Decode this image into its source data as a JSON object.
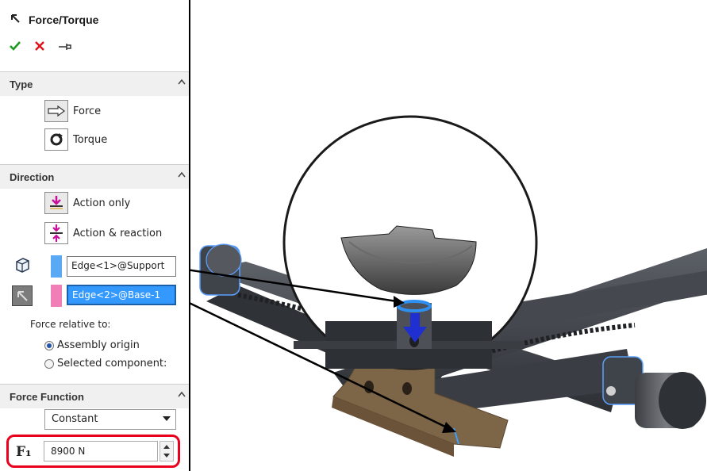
{
  "panel": {
    "title": "Force/Torque",
    "type_section": {
      "title": "Type",
      "options": [
        "Force",
        "Torque"
      ]
    },
    "direction_section": {
      "title": "Direction",
      "options": [
        "Action only",
        "Action & reaction"
      ],
      "selection1": "Edge<1>@Support",
      "selection2": "Edge<2>@Base-1",
      "force_relative_label": "Force relative to:",
      "radio_options": [
        "Assembly origin",
        "Selected component:"
      ],
      "selected_radio": "Assembly origin"
    },
    "function_section": {
      "title": "Force Function",
      "function_value": "Constant",
      "f1_label": "F₁",
      "f1_value": "8900 N"
    }
  },
  "colors": {
    "selection1_swatch": "#5aa9f5",
    "selection2_swatch": "#f07fb8",
    "active_field": "#3399ff",
    "highlight": "#e8001c",
    "base_part": "#7d6548",
    "frame": "#4b4f55"
  },
  "icons": [
    "back-arrow-icon",
    "ok-check-icon",
    "cancel-x-icon",
    "pin-icon",
    "force-icon",
    "torque-icon",
    "action-only-icon",
    "action-reaction-icon",
    "component-icon",
    "direction-arrow-icon"
  ]
}
